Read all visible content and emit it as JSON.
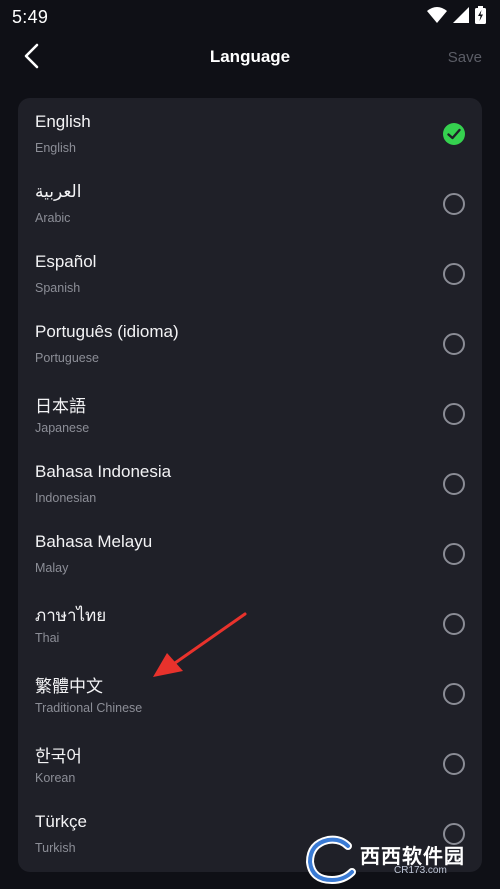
{
  "status_bar": {
    "time": "5:49",
    "icons": [
      "wifi-icon",
      "cellular-icon",
      "battery-charging-icon"
    ]
  },
  "header": {
    "title": "Language",
    "save_label": "Save",
    "back_icon": "chevron-left-icon"
  },
  "languages": [
    {
      "name": "English",
      "subtitle": "English",
      "selected": true
    },
    {
      "name": "العربية",
      "subtitle": "Arabic",
      "selected": false
    },
    {
      "name": "Español",
      "subtitle": "Spanish",
      "selected": false
    },
    {
      "name": "Português (idioma)",
      "subtitle": "Portuguese",
      "selected": false
    },
    {
      "name": "日本語",
      "subtitle": "Japanese",
      "selected": false
    },
    {
      "name": "Bahasa Indonesia",
      "subtitle": "Indonesian",
      "selected": false
    },
    {
      "name": "Bahasa Melayu",
      "subtitle": "Malay",
      "selected": false
    },
    {
      "name": "ภาษาไทย",
      "subtitle": "Thai",
      "selected": false
    },
    {
      "name": "繁體中文",
      "subtitle": "Traditional Chinese",
      "selected": false
    },
    {
      "name": "한국어",
      "subtitle": "Korean",
      "selected": false
    },
    {
      "name": "Türkçe",
      "subtitle": "Turkish",
      "selected": false
    }
  ],
  "colors": {
    "background": "#0f1016",
    "card": "#1f2028",
    "selected": "#35d14f",
    "annotation_arrow": "#e8322c"
  },
  "watermark": {
    "logo_text": "西西软件园",
    "url_text": "CR173.com"
  }
}
